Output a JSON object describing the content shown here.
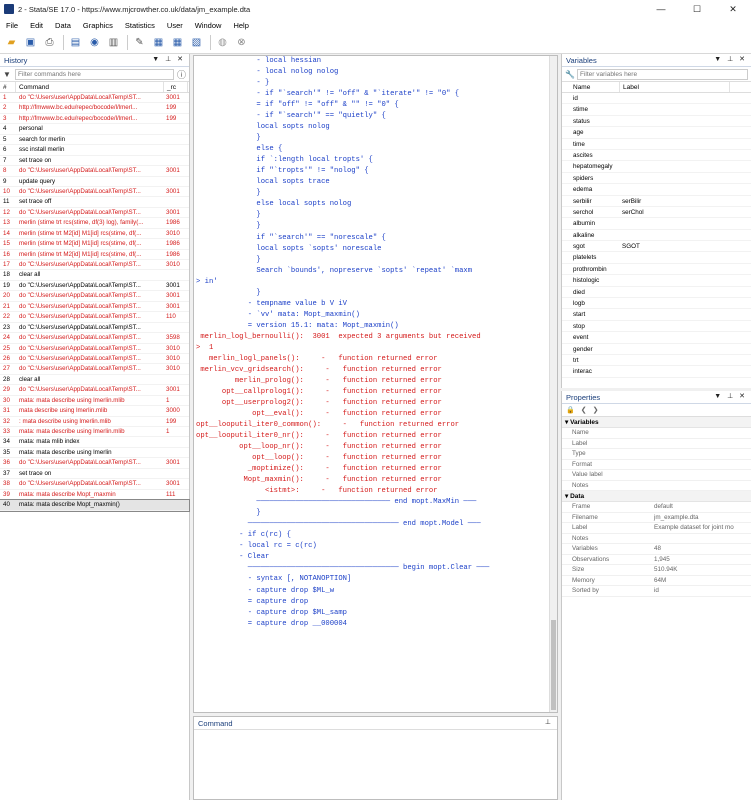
{
  "window": {
    "title": "2 - Stata/SE 17.0 - https://www.mjcrowther.co.uk/data/jm_example.dta",
    "minimize": "—",
    "maximize": "☐",
    "close": "✕"
  },
  "menu": [
    "File",
    "Edit",
    "Data",
    "Graphics",
    "Statistics",
    "User",
    "Window",
    "Help"
  ],
  "history": {
    "title": "History",
    "filter_placeholder": "Filter commands here",
    "columns": [
      "#",
      "Command",
      "_rc"
    ],
    "rows": [
      {
        "n": "1",
        "cmd": "do \"C:\\Users\\user\\AppData\\Local\\Temp\\ST...",
        "rc": "3001",
        "err": true
      },
      {
        "n": "2",
        "cmd": "http://fmwww.bc.edu/repec/bocode/l/lmerl...",
        "rc": "199",
        "err": true
      },
      {
        "n": "3",
        "cmd": "http://fmwww.bc.edu/repec/bocode/l/lmerl...",
        "rc": "199",
        "err": true
      },
      {
        "n": "4",
        "cmd": "personal",
        "rc": "",
        "err": false
      },
      {
        "n": "5",
        "cmd": "search for merlin",
        "rc": "",
        "err": false
      },
      {
        "n": "6",
        "cmd": "ssc install merlin",
        "rc": "",
        "err": false
      },
      {
        "n": "7",
        "cmd": "set trace on",
        "rc": "",
        "err": false
      },
      {
        "n": "8",
        "cmd": "do \"C:\\Users\\user\\AppData\\Local\\Temp\\ST...",
        "rc": "3001",
        "err": true
      },
      {
        "n": "9",
        "cmd": "update query",
        "rc": "",
        "err": false
      },
      {
        "n": "10",
        "cmd": "do \"C:\\Users\\user\\AppData\\Local\\Temp\\ST...",
        "rc": "3001",
        "err": true
      },
      {
        "n": "11",
        "cmd": "set trace off",
        "rc": "",
        "err": false
      },
      {
        "n": "12",
        "cmd": "do \"C:\\Users\\user\\AppData\\Local\\Temp\\ST...",
        "rc": "3001",
        "err": true
      },
      {
        "n": "13",
        "cmd": "merlin (stime trt rcs(stime, df(3) log), family(...",
        "rc": "1986",
        "err": true
      },
      {
        "n": "14",
        "cmd": "merlin (stime trt M2[id] M1[id] rcs(stime, df(...",
        "rc": "3010",
        "err": true
      },
      {
        "n": "15",
        "cmd": "merlin (stime trt M2[id] M1[id] rcs(stime, df(...",
        "rc": "1986",
        "err": true
      },
      {
        "n": "16",
        "cmd": "merlin (stime trt M2[id] M1[id] rcs(stime, df(...",
        "rc": "1986",
        "err": true
      },
      {
        "n": "17",
        "cmd": "do \"C:\\Users\\user\\AppData\\Local\\Temp\\ST...",
        "rc": "3010",
        "err": true
      },
      {
        "n": "18",
        "cmd": "clear all",
        "rc": "",
        "err": false
      },
      {
        "n": "19",
        "cmd": "do \"C:\\Users\\user\\AppData\\Local\\Temp\\ST...",
        "rc": "3001",
        "err": false
      },
      {
        "n": "20",
        "cmd": "do \"C:\\Users\\user\\AppData\\Local\\Temp\\ST...",
        "rc": "3001",
        "err": true
      },
      {
        "n": "21",
        "cmd": "do \"C:\\Users\\user\\AppData\\Local\\Temp\\ST...",
        "rc": "3001",
        "err": true
      },
      {
        "n": "22",
        "cmd": "do \"C:\\Users\\user\\AppData\\Local\\Temp\\ST...",
        "rc": "110",
        "err": true
      },
      {
        "n": "23",
        "cmd": "do \"C:\\Users\\user\\AppData\\Local\\Temp\\ST...",
        "rc": "",
        "err": false
      },
      {
        "n": "24",
        "cmd": "do \"C:\\Users\\user\\AppData\\Local\\Temp\\ST...",
        "rc": "3598",
        "err": true
      },
      {
        "n": "25",
        "cmd": "do \"C:\\Users\\user\\AppData\\Local\\Temp\\ST...",
        "rc": "3010",
        "err": true
      },
      {
        "n": "26",
        "cmd": "do \"C:\\Users\\user\\AppData\\Local\\Temp\\ST...",
        "rc": "3010",
        "err": true
      },
      {
        "n": "27",
        "cmd": "do \"C:\\Users\\user\\AppData\\Local\\Temp\\ST...",
        "rc": "3010",
        "err": true
      },
      {
        "n": "28",
        "cmd": "clear all",
        "rc": "",
        "err": false
      },
      {
        "n": "29",
        "cmd": "do \"C:\\Users\\user\\AppData\\Local\\Temp\\ST...",
        "rc": "3001",
        "err": true
      },
      {
        "n": "30",
        "cmd": "mata: mata describe using lmerlin.mlib",
        "rc": "1",
        "err": true
      },
      {
        "n": "31",
        "cmd": "mata describe using lmerlin.mlib",
        "rc": "3000",
        "err": true
      },
      {
        "n": "32",
        "cmd": ": mata describe using lmerlin.mlib",
        "rc": "199",
        "err": true
      },
      {
        "n": "33",
        "cmd": "mata: mata describe using lmerlin.mlib",
        "rc": "1",
        "err": true
      },
      {
        "n": "34",
        "cmd": "mata: mata mlib index",
        "rc": "",
        "err": false
      },
      {
        "n": "35",
        "cmd": "mata: mata describe using lmerlin",
        "rc": "",
        "err": false
      },
      {
        "n": "36",
        "cmd": "do \"C:\\Users\\user\\AppData\\Local\\Temp\\ST...",
        "rc": "3001",
        "err": true
      },
      {
        "n": "37",
        "cmd": "set trace on",
        "rc": "",
        "err": false
      },
      {
        "n": "38",
        "cmd": "do \"C:\\Users\\user\\AppData\\Local\\Temp\\ST...",
        "rc": "3001",
        "err": true
      },
      {
        "n": "39",
        "cmd": "mata: mata describe Mopt_maxmin",
        "rc": "111",
        "err": true
      },
      {
        "n": "40",
        "cmd": "mata: mata describe Mopt_maxmin()",
        "rc": "",
        "err": false,
        "selected": true
      }
    ]
  },
  "results": [
    {
      "t": "              - local hessian",
      "err": false
    },
    {
      "t": "              - local nolog nolog",
      "err": false
    },
    {
      "t": "              - }",
      "err": false
    },
    {
      "t": "              - if \"`search'\" != \"off\" & \"`iterate'\" != \"0\" {",
      "err": false
    },
    {
      "t": "              = if \"off\" != \"off\" & \"\" != \"0\" {",
      "err": false
    },
    {
      "t": "              - if \"`search'\" == \"quietly\" {",
      "err": false
    },
    {
      "t": "              local sopts nolog",
      "err": false
    },
    {
      "t": "              }",
      "err": false
    },
    {
      "t": "              else {",
      "err": false
    },
    {
      "t": "              if `:length local tropts' {",
      "err": false
    },
    {
      "t": "              if \"`tropts'\" != \"nolog\" {",
      "err": false
    },
    {
      "t": "              local sopts trace",
      "err": false
    },
    {
      "t": "              }",
      "err": false
    },
    {
      "t": "              else local sopts nolog",
      "err": false
    },
    {
      "t": "              }",
      "err": false
    },
    {
      "t": "              }",
      "err": false
    },
    {
      "t": "              if \"`search'\" == \"norescale\" {",
      "err": false
    },
    {
      "t": "              local sopts `sopts' norescale",
      "err": false
    },
    {
      "t": "              }",
      "err": false
    },
    {
      "t": "              Search `bounds', nopreserve `sopts' `repeat' `maxm",
      "err": false
    },
    {
      "t": "> in'",
      "err": false
    },
    {
      "t": "              }",
      "err": false
    },
    {
      "t": "            - tempname value b V iV",
      "err": false
    },
    {
      "t": "            - `vv' mata: Mopt_maxmin()",
      "err": false
    },
    {
      "t": "            = version 15.1: mata: Mopt_maxmin()",
      "err": false
    },
    {
      "t": " merlin_logl_bernoulli():  3001  expected 3 arguments but received",
      "err": true
    },
    {
      "t": ">  1",
      "err": true
    },
    {
      "t": "   merlin_logl_panels():     -   function returned error",
      "err": true
    },
    {
      "t": " merlin_vcv_gridsearch():     -   function returned error",
      "err": true
    },
    {
      "t": "         merlin_prolog():     -   function returned error",
      "err": true
    },
    {
      "t": "      opt__callprolog1():     -   function returned error",
      "err": true
    },
    {
      "t": "      opt__userprolog2():     -   function returned error",
      "err": true
    },
    {
      "t": "             opt__eval():     -   function returned error",
      "err": true
    },
    {
      "t": "opt__looputil_iter0_common():     -   function returned error",
      "err": true
    },
    {
      "t": "opt__looputil_iter0_nr():     -   function returned error",
      "err": true
    },
    {
      "t": "          opt__loop_nr():     -   function returned error",
      "err": true
    },
    {
      "t": "             opt__loop():     -   function returned error",
      "err": true
    },
    {
      "t": "            _moptimize():     -   function returned error",
      "err": true
    },
    {
      "t": "           Mopt_maxmin():     -   function returned error",
      "err": true
    },
    {
      "t": "                <istmt>:     -   function returned error",
      "err": true
    },
    {
      "t": "              ─────────────────────────────── end mopt.MaxMin ───",
      "err": false
    },
    {
      "t": "              }",
      "err": false
    },
    {
      "t": "            ─────────────────────────────────── end mopt.Model ───",
      "err": false
    },
    {
      "t": "          - if c(rc) {",
      "err": false
    },
    {
      "t": "          - local rc = c(rc)",
      "err": false
    },
    {
      "t": "          - Clear",
      "err": false
    },
    {
      "t": "            ─────────────────────────────────── begin mopt.Clear ───",
      "err": false
    },
    {
      "t": "            - syntax [, NOTANOPTION]",
      "err": false
    },
    {
      "t": "            - capture drop $ML_w",
      "err": false
    },
    {
      "t": "            = capture drop",
      "err": false
    },
    {
      "t": "            - capture drop $ML_samp",
      "err": false
    },
    {
      "t": "            = capture drop __000004",
      "err": false
    }
  ],
  "command": {
    "title": "Command"
  },
  "variables": {
    "title": "Variables",
    "filter_placeholder": "Filter variables here",
    "columns": [
      "Name",
      "Label"
    ],
    "rows": [
      {
        "n": "id",
        "l": ""
      },
      {
        "n": "stime",
        "l": ""
      },
      {
        "n": "status",
        "l": ""
      },
      {
        "n": "age",
        "l": ""
      },
      {
        "n": "time",
        "l": ""
      },
      {
        "n": "ascites",
        "l": ""
      },
      {
        "n": "hepatomegaly",
        "l": ""
      },
      {
        "n": "spiders",
        "l": ""
      },
      {
        "n": "edema",
        "l": ""
      },
      {
        "n": "serbilir",
        "l": "serBilir"
      },
      {
        "n": "serchol",
        "l": "serChol"
      },
      {
        "n": "albumin",
        "l": ""
      },
      {
        "n": "alkaline",
        "l": ""
      },
      {
        "n": "sgot",
        "l": "SGOT"
      },
      {
        "n": "platelets",
        "l": ""
      },
      {
        "n": "prothrombin",
        "l": ""
      },
      {
        "n": "histologic",
        "l": ""
      },
      {
        "n": "died",
        "l": ""
      },
      {
        "n": "logb",
        "l": ""
      },
      {
        "n": "start",
        "l": ""
      },
      {
        "n": "stop",
        "l": ""
      },
      {
        "n": "event",
        "l": ""
      },
      {
        "n": "gender",
        "l": ""
      },
      {
        "n": "trt",
        "l": ""
      },
      {
        "n": "interac",
        "l": ""
      }
    ]
  },
  "properties": {
    "title": "Properties",
    "sections": [
      {
        "name": "Variables",
        "rows": [
          {
            "k": "Name",
            "v": ""
          },
          {
            "k": "Label",
            "v": ""
          },
          {
            "k": "Type",
            "v": ""
          },
          {
            "k": "Format",
            "v": ""
          },
          {
            "k": "Value label",
            "v": ""
          },
          {
            "k": "Notes",
            "v": ""
          }
        ]
      },
      {
        "name": "Data",
        "rows": [
          {
            "k": "Frame",
            "v": "default"
          },
          {
            "k": "Filename",
            "v": "jm_example.dta"
          },
          {
            "k": "Label",
            "v": "Example dataset for joint mo"
          },
          {
            "k": "Notes",
            "v": ""
          },
          {
            "k": "Variables",
            "v": "48"
          },
          {
            "k": "Observations",
            "v": "1,945"
          },
          {
            "k": "Size",
            "v": "510.94K"
          },
          {
            "k": "Memory",
            "v": "64M"
          },
          {
            "k": "Sorted by",
            "v": "id"
          }
        ]
      }
    ]
  },
  "colors": {
    "error": "#d41a1a",
    "code": "#1a3ec7",
    "panel_title": "#1a3e7a"
  }
}
